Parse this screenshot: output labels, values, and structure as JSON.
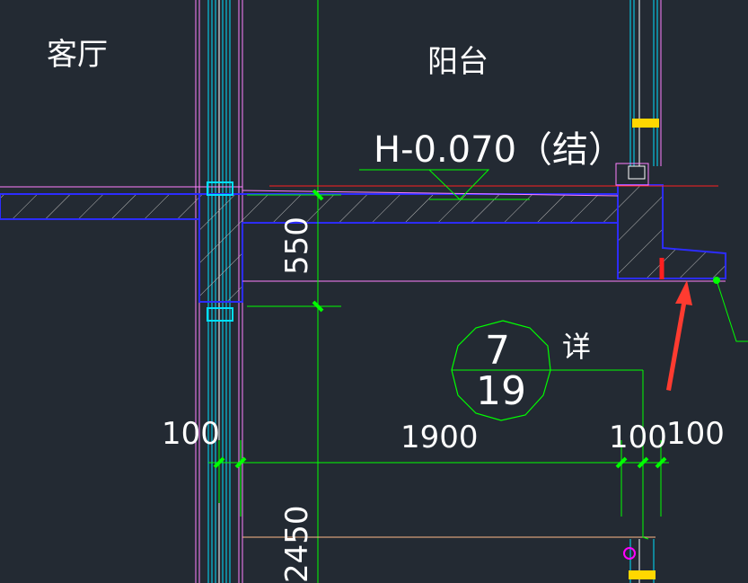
{
  "colors": {
    "background": "#232a33",
    "wall": "#ff80ff",
    "slab": "#2c2cff",
    "dim": "#00ff00",
    "axis": "#00ff00",
    "glass": "#00e0ff",
    "red": "#ff2020",
    "arrow": "#ff3b30",
    "hatch": "#b8b8b8",
    "text": "#ffffff",
    "fitting": "#ffd700"
  },
  "labels": {
    "room_left": "客厅",
    "room_right": "阳台",
    "elevation": "H-0.070（结）",
    "detail_label": "详"
  },
  "detail": {
    "number": "7",
    "sheet": "19"
  },
  "dimensions": {
    "beam_depth": "550",
    "lower_dim": "2450",
    "d1": "100",
    "d2": "1900",
    "d3": "100",
    "d4": "100"
  },
  "icons": {
    "arrow": "red-arrow-icon",
    "fitting": "window-fitting-icon"
  }
}
